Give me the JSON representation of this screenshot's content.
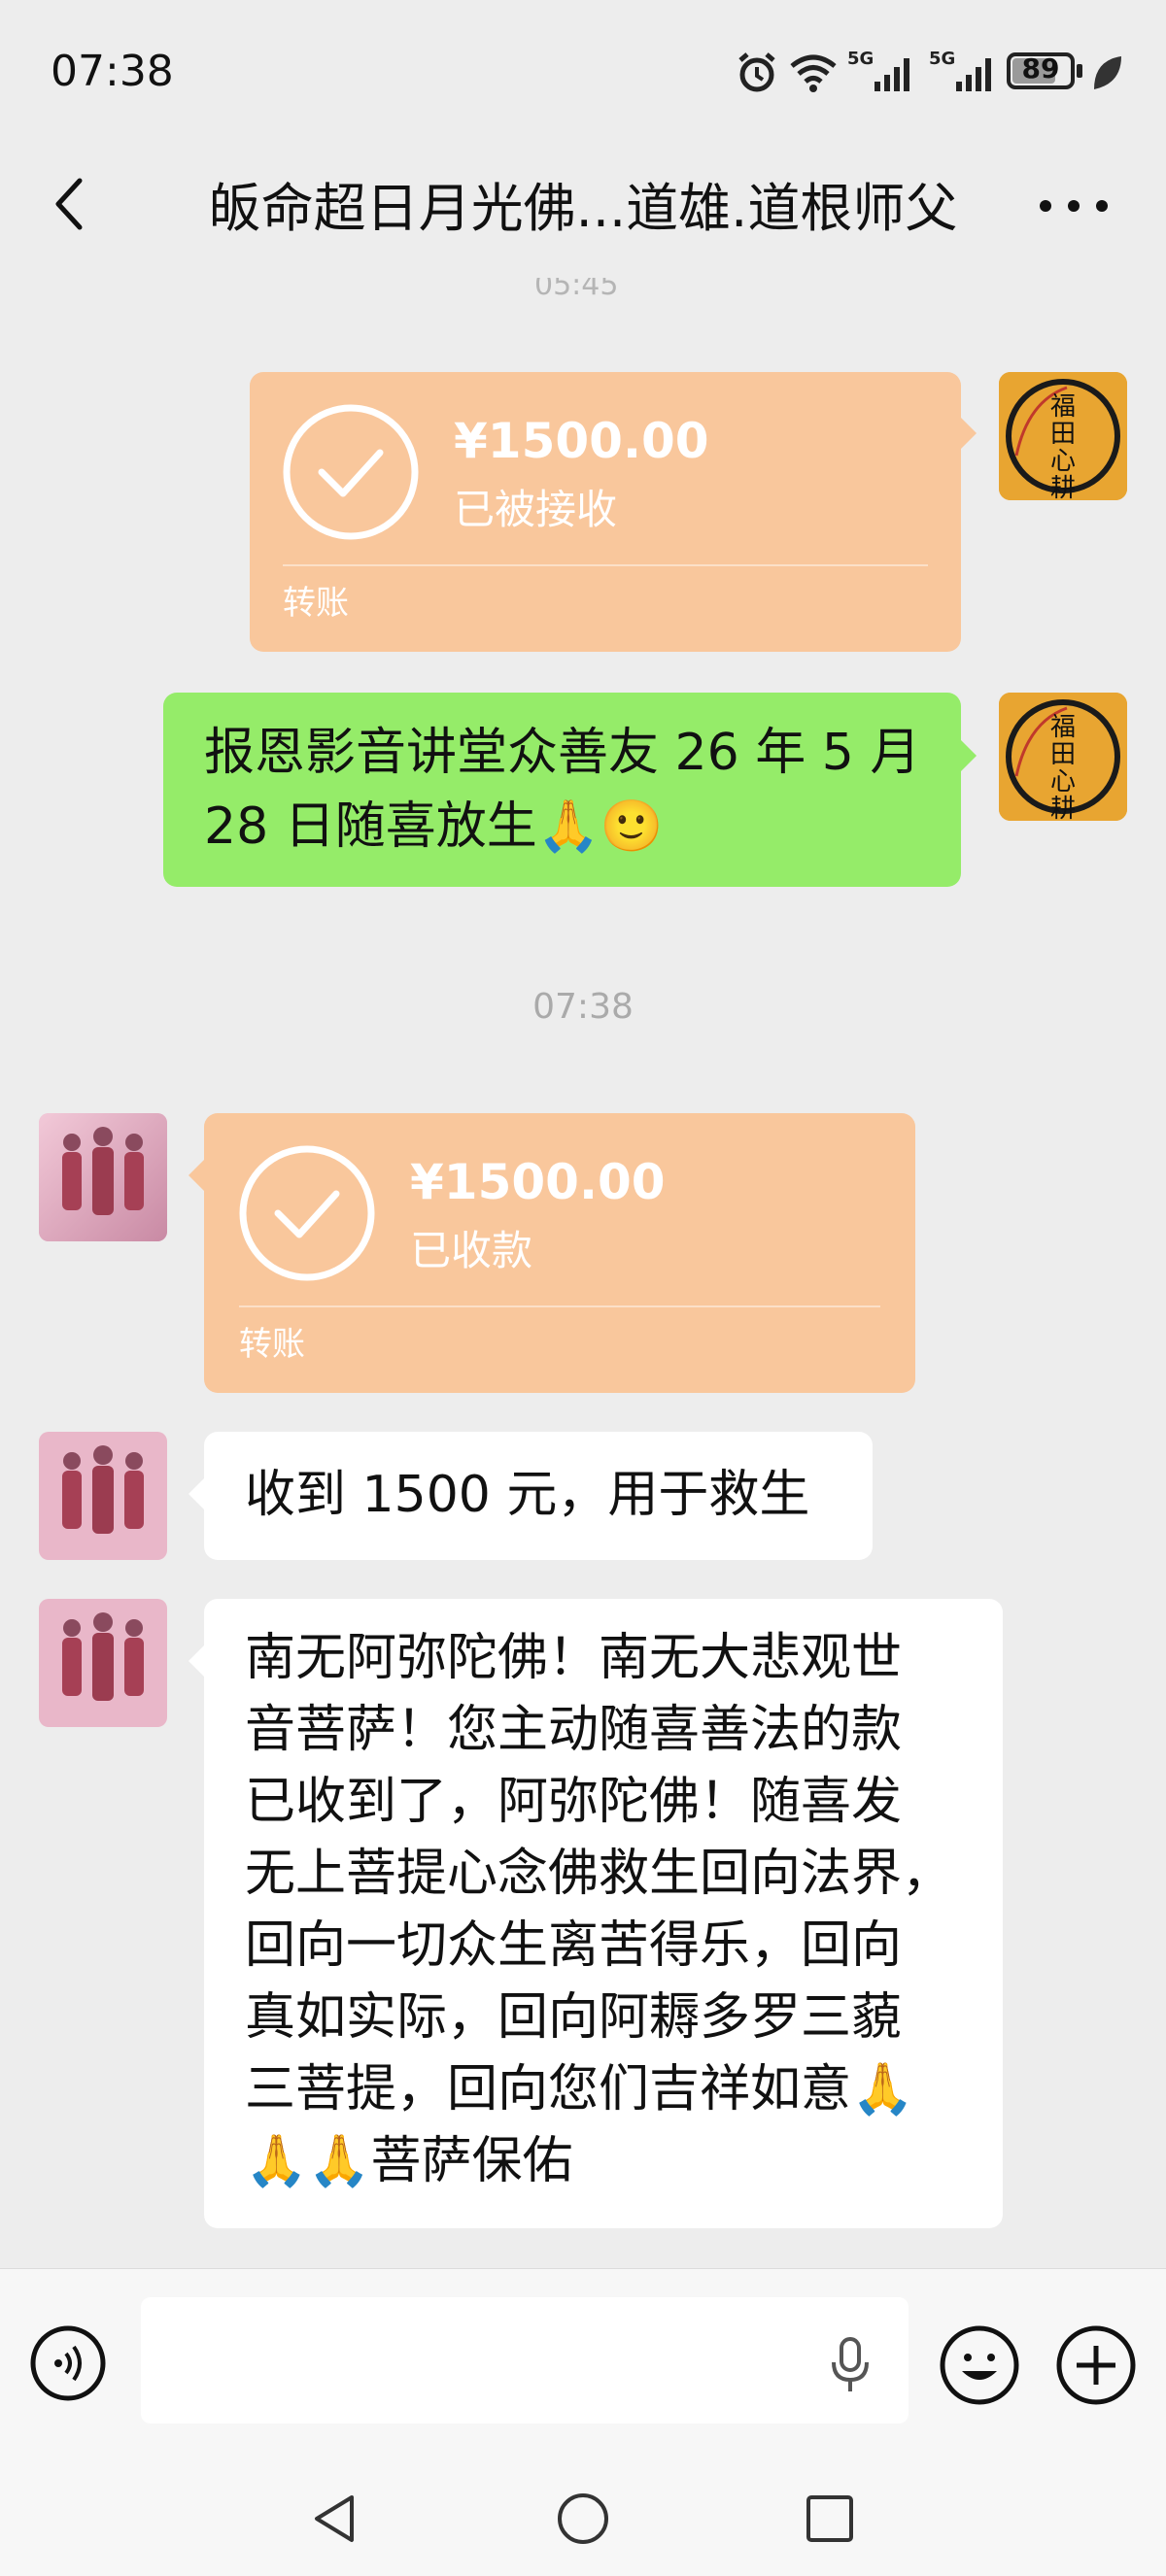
{
  "status_bar": {
    "time": "07:38",
    "battery": "89",
    "signal1": "5G",
    "signal2": "5G"
  },
  "header": {
    "title": "皈命超日月光佛...道雄.道根师父",
    "top_clip_time": "05:45"
  },
  "messages": [
    {
      "type": "transfer",
      "sender": "self",
      "amount": "¥1500.00",
      "status": "已被接收",
      "footer": "转账"
    },
    {
      "type": "text",
      "sender": "self",
      "lines": [
        "报恩影音讲堂众善友 26 年 5 月",
        "28 日随喜放生🙏🙂"
      ]
    },
    {
      "type": "time",
      "text": "07:38"
    },
    {
      "type": "transfer",
      "sender": "other",
      "amount": "¥1500.00",
      "status": "已收款",
      "footer": "转账"
    },
    {
      "type": "text",
      "sender": "other",
      "text": "收到 1500 元，用于救生"
    },
    {
      "type": "text",
      "sender": "other",
      "lines": [
        "南无阿弥陀佛！南无大悲观世",
        "音菩萨！您主动随喜善法的款",
        "已收到了，阿弥陀佛！随喜发",
        "无上菩提心念佛救生回向法界，",
        "回向一切众生离苦得乐，回向",
        "真如实际，回向阿耨多罗三藐",
        "三菩提，回向您们吉祥如意🙏",
        "🙏🙏菩萨保佑"
      ]
    }
  ],
  "avatar_self": {
    "chars": [
      "福",
      "田",
      "心",
      "耕"
    ]
  },
  "input_bar": {
    "voice_icon": "voice-icon",
    "emoji_icon": "emoji-icon",
    "plus_icon": "plus-icon"
  },
  "nav_bar": {
    "back": "back-nav-icon",
    "home": "home-nav-icon",
    "recents": "recents-nav-icon"
  },
  "colors": {
    "bg": "#ededed",
    "transfer": "#f9c79c",
    "self_bubble": "#95ec69",
    "other_bubble": "#ffffff"
  }
}
